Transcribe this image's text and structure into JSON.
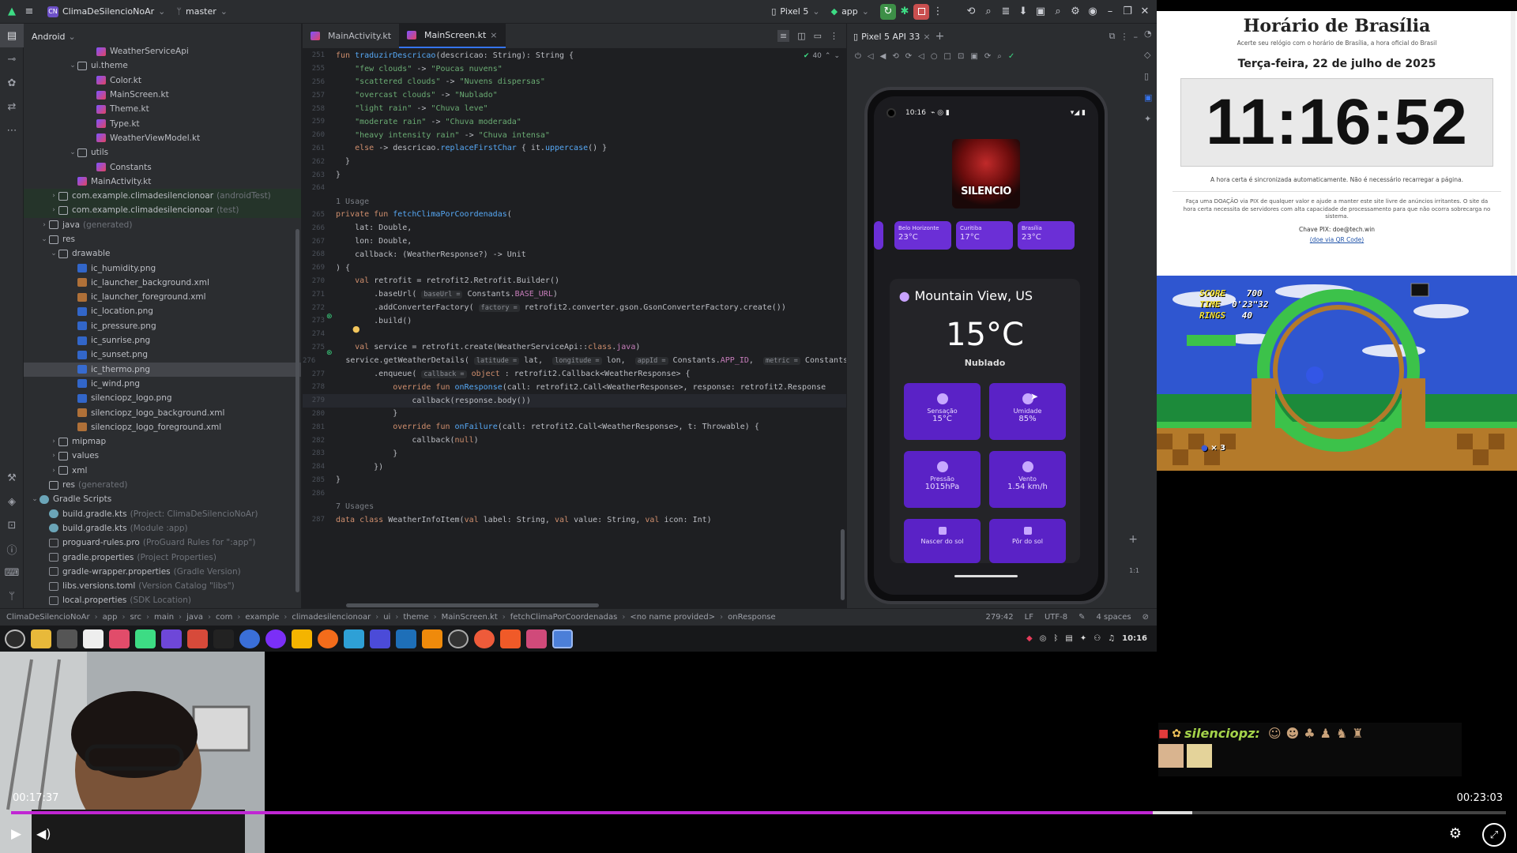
{
  "ide": {
    "project_name": "ClimaDeSilencioNoAr",
    "branch": "master",
    "device": "Pixel 5",
    "run_config": "app",
    "project_view": "Android",
    "tree": [
      {
        "label": "WeatherServiceApi",
        "indent": 6,
        "icon": "kt"
      },
      {
        "label": "ui.theme",
        "indent": 4,
        "icon": "folder",
        "twisty": "v"
      },
      {
        "label": "Color.kt",
        "indent": 6,
        "icon": "kt"
      },
      {
        "label": "MainScreen.kt",
        "indent": 6,
        "icon": "kt"
      },
      {
        "label": "Theme.kt",
        "indent": 6,
        "icon": "kt"
      },
      {
        "label": "Type.kt",
        "indent": 6,
        "icon": "kt"
      },
      {
        "label": "WeatherViewModel.kt",
        "indent": 6,
        "icon": "kt"
      },
      {
        "label": "utils",
        "indent": 4,
        "icon": "folder",
        "twisty": "v"
      },
      {
        "label": "Constants",
        "indent": 6,
        "icon": "kt"
      },
      {
        "label": "MainActivity.kt",
        "indent": 4,
        "icon": "kt"
      },
      {
        "label": "com.example.climadesilencionoar",
        "hint": "(androidTest)",
        "indent": 2,
        "icon": "folder",
        "twisty": ">",
        "style": "grn"
      },
      {
        "label": "com.example.climadesilencionoar",
        "hint": "(test)",
        "indent": 2,
        "icon": "folder",
        "twisty": ">",
        "style": "grn"
      },
      {
        "label": "java",
        "hint": "(generated)",
        "indent": 1,
        "icon": "folder",
        "twisty": ">"
      },
      {
        "label": "res",
        "indent": 1,
        "icon": "folder",
        "twisty": "v"
      },
      {
        "label": "drawable",
        "indent": 2,
        "icon": "folder",
        "twisty": "v"
      },
      {
        "label": "ic_humidity.png",
        "indent": 4,
        "icon": "png"
      },
      {
        "label": "ic_launcher_background.xml",
        "indent": 4,
        "icon": "xml"
      },
      {
        "label": "ic_launcher_foreground.xml",
        "indent": 4,
        "icon": "xml"
      },
      {
        "label": "ic_location.png",
        "indent": 4,
        "icon": "png"
      },
      {
        "label": "ic_pressure.png",
        "indent": 4,
        "icon": "png"
      },
      {
        "label": "ic_sunrise.png",
        "indent": 4,
        "icon": "png"
      },
      {
        "label": "ic_sunset.png",
        "indent": 4,
        "icon": "png"
      },
      {
        "label": "ic_thermo.png",
        "indent": 4,
        "icon": "png",
        "style": "sel"
      },
      {
        "label": "ic_wind.png",
        "indent": 4,
        "icon": "png"
      },
      {
        "label": "silenciopz_logo.png",
        "indent": 4,
        "icon": "png"
      },
      {
        "label": "silenciopz_logo_background.xml",
        "indent": 4,
        "icon": "xml"
      },
      {
        "label": "silenciopz_logo_foreground.xml",
        "indent": 4,
        "icon": "xml"
      },
      {
        "label": "mipmap",
        "indent": 2,
        "icon": "folder",
        "twisty": ">"
      },
      {
        "label": "values",
        "indent": 2,
        "icon": "folder",
        "twisty": ">"
      },
      {
        "label": "xml",
        "indent": 2,
        "icon": "folder",
        "twisty": ">"
      },
      {
        "label": "res",
        "hint": "(generated)",
        "indent": 1,
        "icon": "folder"
      },
      {
        "label": "Gradle Scripts",
        "indent": 0,
        "icon": "gradle",
        "twisty": "v"
      },
      {
        "label": "build.gradle.kts",
        "hint": "(Project: ClimaDeSilencioNoAr)",
        "indent": 1,
        "icon": "gradle"
      },
      {
        "label": "build.gradle.kts",
        "hint": "(Module :app)",
        "indent": 1,
        "icon": "gradle"
      },
      {
        "label": "proguard-rules.pro",
        "hint": "(ProGuard Rules for \":app\")",
        "indent": 1,
        "icon": "file"
      },
      {
        "label": "gradle.properties",
        "hint": "(Project Properties)",
        "indent": 1,
        "icon": "file"
      },
      {
        "label": "gradle-wrapper.properties",
        "hint": "(Gradle Version)",
        "indent": 1,
        "icon": "file"
      },
      {
        "label": "libs.versions.toml",
        "hint": "(Version Catalog \"libs\")",
        "indent": 1,
        "icon": "file"
      },
      {
        "label": "local.properties",
        "hint": "(SDK Location)",
        "indent": 1,
        "icon": "file"
      }
    ],
    "tabs": [
      {
        "label": "MainActivity.kt",
        "active": false
      },
      {
        "label": "MainScreen.kt",
        "active": true
      }
    ],
    "warnings": "40",
    "code_lines": [
      {
        "n": "251",
        "html": "<span class='k'>fun </span><span class='f'>traduzirDescricao</span>(descricao: String): String {"
      },
      {
        "n": "255",
        "html": "    <span class='s'>\"few clouds\"</span> -> <span class='s'>\"Poucas nuvens\"</span>"
      },
      {
        "n": "256",
        "html": "    <span class='s'>\"scattered clouds\"</span> -> <span class='s'>\"Nuvens dispersas\"</span>"
      },
      {
        "n": "257",
        "html": "    <span class='s'>\"overcast clouds\"</span> -> <span class='s'>\"Nublado\"</span>"
      },
      {
        "n": "258",
        "html": "    <span class='s'>\"light rain\"</span> -> <span class='s'>\"Chuva leve\"</span>"
      },
      {
        "n": "259",
        "html": "    <span class='s'>\"moderate rain\"</span> -> <span class='s'>\"Chuva moderada\"</span>"
      },
      {
        "n": "260",
        "html": "    <span class='s'>\"heavy intensity rain\"</span> -> <span class='s'>\"Chuva intensa\"</span>"
      },
      {
        "n": "261",
        "html": "    <span class='k'>else</span> -> descricao.<span class='f'>replaceFirstChar</span> { it.<span class='f'>uppercase</span>() }"
      },
      {
        "n": "262",
        "html": "  }"
      },
      {
        "n": "263",
        "html": "}"
      },
      {
        "n": "264",
        "html": ""
      },
      {
        "n": "",
        "html": "<span class='c'>1 Usage</span>"
      },
      {
        "n": "265",
        "html": "<span class='k'>private fun </span><span class='f'>fetchClimaPorCoordenadas</span>("
      },
      {
        "n": "266",
        "html": "    lat: Double,"
      },
      {
        "n": "267",
        "html": "    lon: Double,"
      },
      {
        "n": "268",
        "html": "    callback: (WeatherResponse?) -> Unit"
      },
      {
        "n": "269",
        "html": ") {"
      },
      {
        "n": "270",
        "html": "    <span class='k'>val </span>retrofit = retrofit2.Retrofit.Builder()"
      },
      {
        "n": "271",
        "html": "        .baseUrl( <span class='i'>baseUrl =</span> Constants.<span class='p'>BASE_URL</span>)"
      },
      {
        "n": "272",
        "html": "        .addConverterFactory( <span class='i'>factory =</span> retrofit2.converter.gson.GsonConverterFactory.create())"
      },
      {
        "n": "273",
        "html": "        .build()"
      },
      {
        "n": "274",
        "html": ""
      },
      {
        "n": "275",
        "html": "    <span class='k'>val </span>service = retrofit.create(WeatherServiceApi::<span class='k'>class</span>.<span class='p'>java</span>)"
      },
      {
        "n": "276",
        "html": "    service.getWeatherDetails( <span class='i'>latitude =</span> lat,  <span class='i'>longitude =</span> lon,  <span class='i'>appId =</span> Constants.<span class='p'>APP_ID</span>,  <span class='i'>metric =</span> Constants"
      },
      {
        "n": "277",
        "html": "        .enqueue( <span class='i'>callback =</span> <span class='k'>object</span> : retrofit2.Callback&lt;WeatherResponse&gt; {"
      },
      {
        "n": "278",
        "html": "            <span class='k'>override fun </span><span class='f'>onResponse</span>(call: retrofit2.Call&lt;WeatherResponse&gt;, response: retrofit2.Response"
      },
      {
        "n": "279",
        "html": "                callback(response.body())"
      },
      {
        "n": "280",
        "html": "            }"
      },
      {
        "n": "281",
        "html": "            <span class='k'>override fun </span><span class='f'>onFailure</span>(call: retrofit2.Call&lt;WeatherResponse&gt;, t: Throwable) {"
      },
      {
        "n": "282",
        "html": "                callback(<span class='k'>null</span>)"
      },
      {
        "n": "283",
        "html": "            }"
      },
      {
        "n": "284",
        "html": "        })"
      },
      {
        "n": "285",
        "html": "}"
      },
      {
        "n": "286",
        "html": ""
      },
      {
        "n": "",
        "html": "<span class='c'>7 Usages</span>"
      },
      {
        "n": "287",
        "html": "<span class='k'>data class </span>WeatherInfoItem(<span class='k'>val </span>label: String, <span class='k'>val </span>value: String, <span class='k'>val </span>icon: Int)"
      }
    ],
    "running_device_tab": "Pixel 5 API 33",
    "breadcrumb": [
      "ClimaDeSilencioNoAr",
      "app",
      "src",
      "main",
      "java",
      "com",
      "example",
      "climadesilencionoar",
      "ui",
      "theme",
      "MainScreen.kt",
      "fetchClimaPorCoordenadas",
      "<no name provided>",
      "onResponse"
    ],
    "cursor_pos": "279:42",
    "line_sep": "LF",
    "encoding": "UTF-8",
    "indent": "4 spaces",
    "tray_time": "10:16"
  },
  "phone": {
    "status_time": "10:16",
    "logo_text": "SILENCIO",
    "cities": [
      {
        "name": "Belo Horizonte",
        "temp": "23°C"
      },
      {
        "name": "Curitiba",
        "temp": "17°C"
      },
      {
        "name": "Brasília",
        "temp": "23°C"
      }
    ],
    "location": "Mountain View, US",
    "temperature": "15°C",
    "condition": "Nublado",
    "tiles": [
      {
        "label": "Sensação",
        "value": "15°C"
      },
      {
        "label": "Umidade",
        "value": "85%"
      },
      {
        "label": "Pressão",
        "value": "1015hPa"
      },
      {
        "label": "Vento",
        "value": "1.54 km/h"
      },
      {
        "label": "Nascer do sol",
        "value": ""
      },
      {
        "label": "Pôr do sol",
        "value": ""
      }
    ]
  },
  "clock": {
    "title": "Horário de Brasília",
    "subtitle": "Acerte seu relógio com o horário de Brasília, a hora oficial do Brasil",
    "date": "Terça-feira, 22 de julho de 2025",
    "time": "11:16:52",
    "sync_note": "A hora certa é sincronizada automaticamente. Não é necessário recarregar a página.",
    "donation_text": "Faça uma DOAÇÃO via PIX de qualquer valor e ajude a manter este site livre de anúncios irritantes. O site da hora certa necessita de servidores com alta capacidade de processamento para que não ocorra sobrecarga no sistema.",
    "pix_key": "Chave PIX: doe@tech.win",
    "qr_link": "(doe via QR Code)"
  },
  "game": {
    "score_label": "SCORE",
    "score": "700",
    "time_label": "TIME",
    "time": "0'23\"32",
    "rings_label": "RINGS",
    "rings": "40",
    "lives": "× 3"
  },
  "chat": {
    "username": "silenciopz:"
  },
  "player": {
    "elapsed": "00:17:37",
    "duration": "00:23:03",
    "progress": 0.764,
    "buffered": 0.79,
    "accent": "#c026d3"
  }
}
